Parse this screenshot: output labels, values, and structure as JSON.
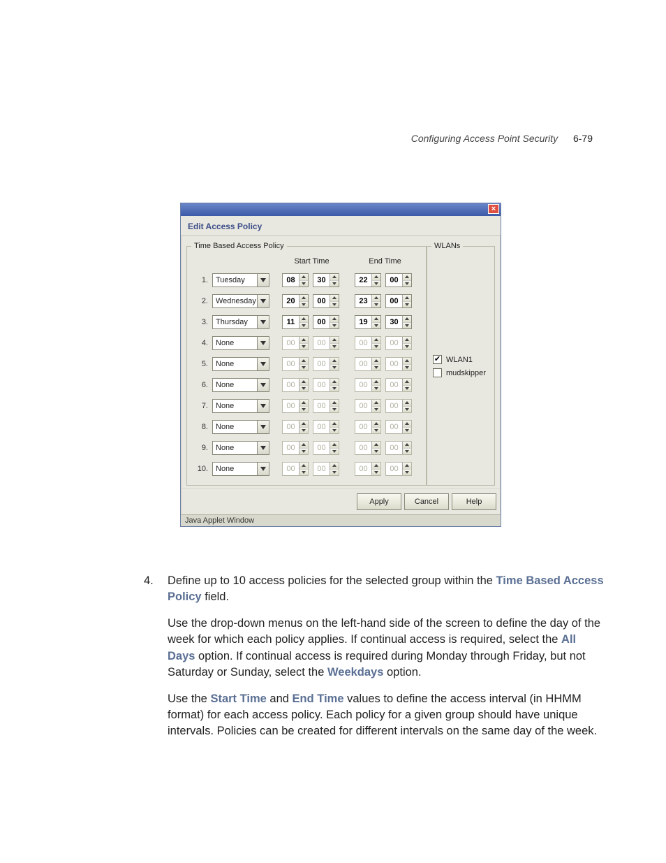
{
  "header": {
    "section": "Configuring Access Point Security",
    "pageno": "6-79"
  },
  "dialog": {
    "title": "Edit Access Policy",
    "timePanel": {
      "legend": "Time Based Access Policy",
      "startLabel": "Start Time",
      "endLabel": "End Time",
      "rows": [
        {
          "n": "1.",
          "day": "Tuesday",
          "enabled": true,
          "sh": "08",
          "sm": "30",
          "eh": "22",
          "em": "00"
        },
        {
          "n": "2.",
          "day": "Wednesday",
          "enabled": true,
          "sh": "20",
          "sm": "00",
          "eh": "23",
          "em": "00"
        },
        {
          "n": "3.",
          "day": "Thursday",
          "enabled": true,
          "sh": "11",
          "sm": "00",
          "eh": "19",
          "em": "30"
        },
        {
          "n": "4.",
          "day": "None",
          "enabled": false,
          "sh": "00",
          "sm": "00",
          "eh": "00",
          "em": "00"
        },
        {
          "n": "5.",
          "day": "None",
          "enabled": false,
          "sh": "00",
          "sm": "00",
          "eh": "00",
          "em": "00"
        },
        {
          "n": "6.",
          "day": "None",
          "enabled": false,
          "sh": "00",
          "sm": "00",
          "eh": "00",
          "em": "00"
        },
        {
          "n": "7.",
          "day": "None",
          "enabled": false,
          "sh": "00",
          "sm": "00",
          "eh": "00",
          "em": "00"
        },
        {
          "n": "8.",
          "day": "None",
          "enabled": false,
          "sh": "00",
          "sm": "00",
          "eh": "00",
          "em": "00"
        },
        {
          "n": "9.",
          "day": "None",
          "enabled": false,
          "sh": "00",
          "sm": "00",
          "eh": "00",
          "em": "00"
        },
        {
          "n": "10.",
          "day": "None",
          "enabled": false,
          "sh": "00",
          "sm": "00",
          "eh": "00",
          "em": "00"
        }
      ]
    },
    "wlanPanel": {
      "legend": "WLANs",
      "items": [
        {
          "label": "WLAN1",
          "checked": true
        },
        {
          "label": "mudskipper",
          "checked": false
        }
      ]
    },
    "buttons": {
      "apply": "Apply",
      "cancel": "Cancel",
      "help": "Help"
    },
    "status": "Java Applet Window"
  },
  "doc": {
    "step_number": "4.",
    "p1a": "Define up to 10 access policies for the selected group within the ",
    "p1kw": "Time Based Access Policy",
    "p1b": " field.",
    "p2a": "Use the drop-down menus on the left-hand side of the screen to define the day of the week for which each policy applies. If continual access is required, select the ",
    "p2kw1": "All Days",
    "p2b": " option. If continual access is required during Monday through Friday, but not Saturday or Sunday, select the ",
    "p2kw2": "Weekdays",
    "p2c": " option.",
    "p3a": "Use the ",
    "p3kw1": "Start Time",
    "p3b": " and ",
    "p3kw2": "End Time",
    "p3c": " values to define the access interval (in HHMM format) for each access policy. Each policy for a given group should have unique intervals. Policies can be created for different intervals on the same day of the week."
  }
}
